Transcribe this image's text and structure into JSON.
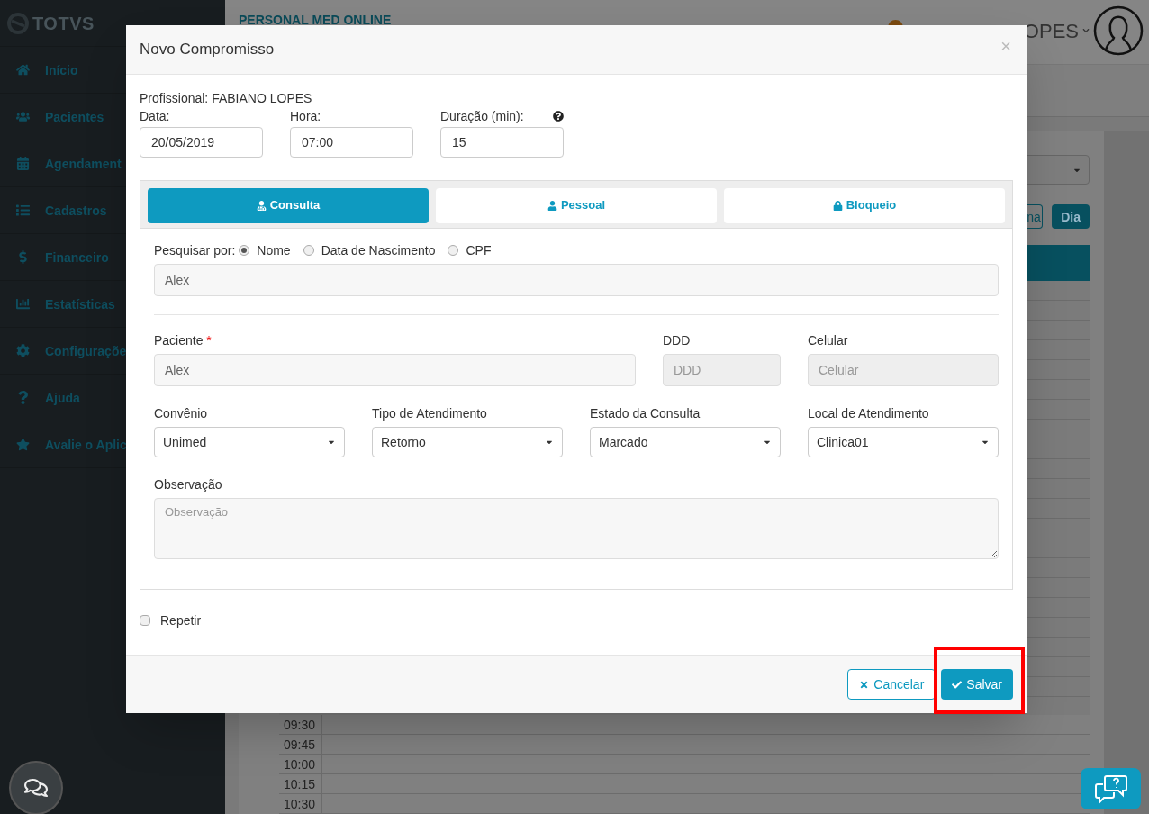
{
  "sidebar": {
    "logo": "TOTVS",
    "items": [
      {
        "label": "Início"
      },
      {
        "label": "Pacientes"
      },
      {
        "label": "Agendament"
      },
      {
        "label": "Cadastros"
      },
      {
        "label": "Financeiro"
      },
      {
        "label": "Estatísticas"
      },
      {
        "label": "Configuraçõe"
      },
      {
        "label": "Ajuda"
      },
      {
        "label": "Avalie o Aplic"
      }
    ]
  },
  "header": {
    "title": "PERSONAL MED ONLINE",
    "user": "OPES"
  },
  "background": {
    "view_buttons": [
      {
        "label": "na",
        "selected": false
      },
      {
        "label": "Dia",
        "selected": true
      }
    ],
    "times": [
      "09:30",
      "09:45",
      "10:00",
      "10:15",
      "10:30"
    ]
  },
  "modal": {
    "title": "Novo Compromisso",
    "close": "×",
    "professional": "Profissional: FABIANO LOPES",
    "fields": [
      {
        "label": "Data:",
        "value": "20/05/2019",
        "help": false
      },
      {
        "label": "Hora:",
        "value": "07:00",
        "help": false
      },
      {
        "label": "Duração (min):",
        "value": "15",
        "help": true
      }
    ],
    "tabs": [
      {
        "label": "Consulta",
        "selected": true
      },
      {
        "label": "Pessoal",
        "selected": false
      },
      {
        "label": "Bloqueio",
        "selected": false
      }
    ],
    "search": {
      "label": "Pesquisar por:",
      "options": [
        {
          "label": "Nome",
          "selected": true
        },
        {
          "label": "Data de Nascimento",
          "selected": false
        },
        {
          "label": "CPF",
          "selected": false
        }
      ],
      "value": "Alex"
    },
    "contact": [
      {
        "label": "Paciente",
        "required_mark": "*",
        "value": "Alex",
        "disabled": false
      },
      {
        "label": "DDD",
        "placeholder": "DDD",
        "disabled": true
      },
      {
        "label": "Celular",
        "placeholder": "Celular",
        "disabled": true
      }
    ],
    "selects": [
      {
        "label": "Convênio",
        "value": "Unimed"
      },
      {
        "label": "Tipo de Atendimento",
        "value": "Retorno"
      },
      {
        "label": "Estado da Consulta",
        "value": "Marcado"
      },
      {
        "label": "Local de Atendimento",
        "value": "Clinica01"
      }
    ],
    "observation": {
      "label": "Observação",
      "placeholder": "Observação"
    },
    "repeat": {
      "label": "Repetir",
      "checked": false
    },
    "buttons": [
      {
        "label": "Cancelar",
        "kind": "cancel",
        "highlighted": false
      },
      {
        "label": "Salvar",
        "kind": "save",
        "highlighted": true
      }
    ]
  }
}
